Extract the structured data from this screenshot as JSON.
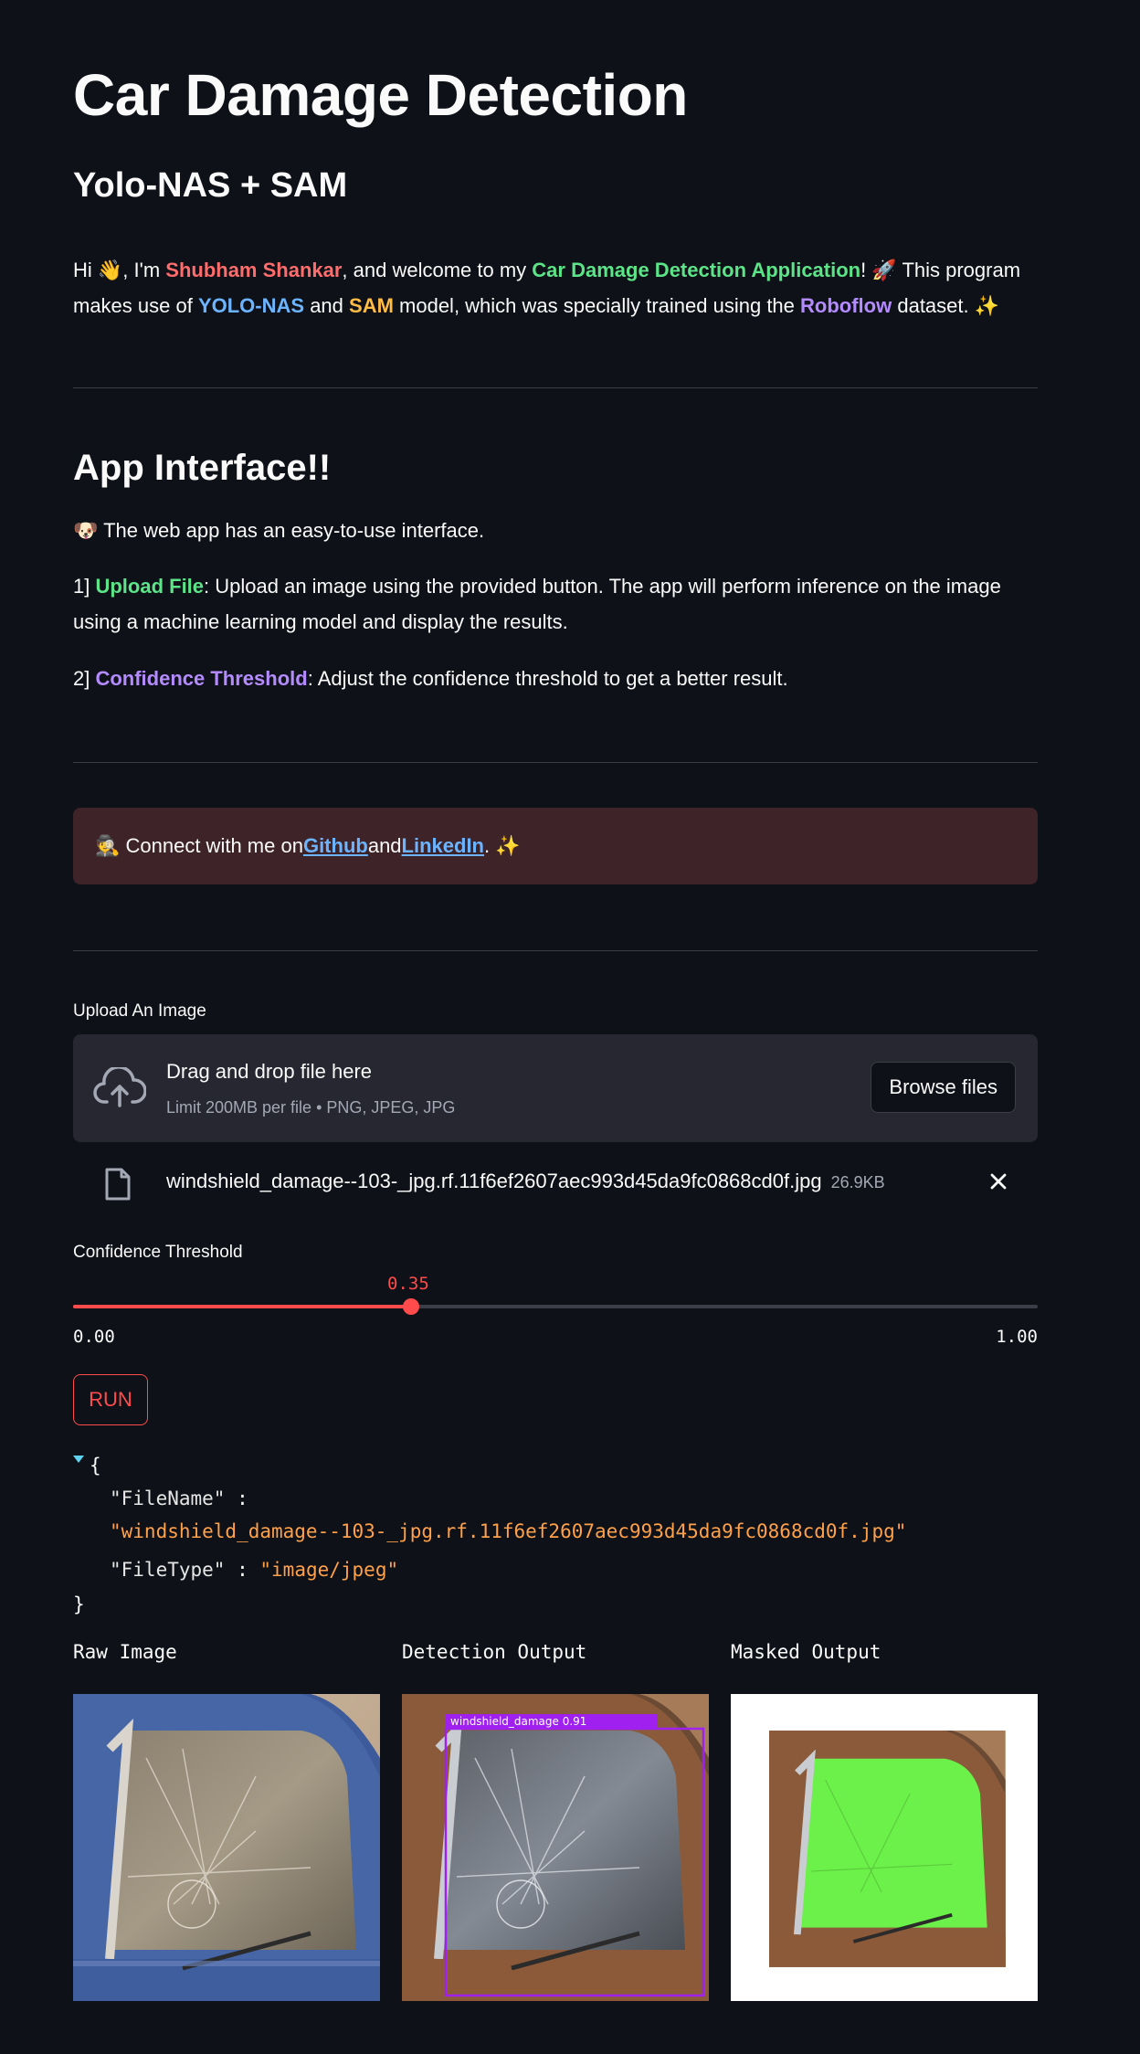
{
  "header": {
    "title": "Car Damage Detection",
    "subtitle": "Yolo-NAS + SAM"
  },
  "intro": {
    "t1": "Hi 👋, I'm ",
    "name": "Shubham Shankar",
    "t2": ", and welcome to my ",
    "app": "Car Damage Detection Application",
    "t3": "! 🚀 This program makes use of ",
    "m1": "YOLO-NAS",
    "t4": " and ",
    "m2": "SAM",
    "t5": " model, which was specially trained using the ",
    "ds": "Roboflow",
    "t6": " dataset. ✨"
  },
  "interface": {
    "heading": "App Interface!!",
    "line": "🐶 The web app has an easy-to-use interface.",
    "item1_prefix": "1] ",
    "item1_key": "Upload File",
    "item1_text": ": Upload an image using the provided button. The app will perform inference on the image using a machine learning model and display the results.",
    "item2_prefix": "2] ",
    "item2_key": "Confidence Threshold",
    "item2_text": ": Adjust the confidence threshold to get a better result."
  },
  "connect": {
    "t1": "🕵️  Connect with me on ",
    "github": "Github",
    "t2": " and ",
    "linkedin": "LinkedIn",
    "t3": ". ✨"
  },
  "uploader": {
    "label": "Upload An Image",
    "drop_text": "Drag and drop file here",
    "limit_text": "Limit 200MB per file • PNG, JPEG, JPG",
    "browse_label": "Browse files",
    "file_name": "windshield_damage--103-_jpg.rf.11f6ef2607aec993d45da9fc0868cd0f.jpg",
    "file_size": "26.9KB"
  },
  "slider": {
    "label": "Confidence Threshold",
    "value": 0.35,
    "value_text": "0.35",
    "min_text": "0.00",
    "max_text": "1.00"
  },
  "run_label": "RUN",
  "json_view": {
    "open": "{",
    "close": "}",
    "k1": "\"FileName\"",
    "v1": "\"windshield_damage--103-_jpg.rf.11f6ef2607aec993d45da9fc0868cd0f.jpg\"",
    "k2": "\"FileType\"",
    "v2": "\"image/jpeg\"",
    "sep": " :"
  },
  "outputs": {
    "raw_title": "Raw Image",
    "det_title": "Detection Output",
    "mask_title": "Masked Output",
    "det_label": "windshield_damage  0.91"
  },
  "colors": {
    "background": "#0e1117",
    "accent": "#ff4b4b",
    "alert_bg": "#3e2428",
    "detect_box": "#a020f0",
    "mask_fill": "#6cf04a"
  }
}
